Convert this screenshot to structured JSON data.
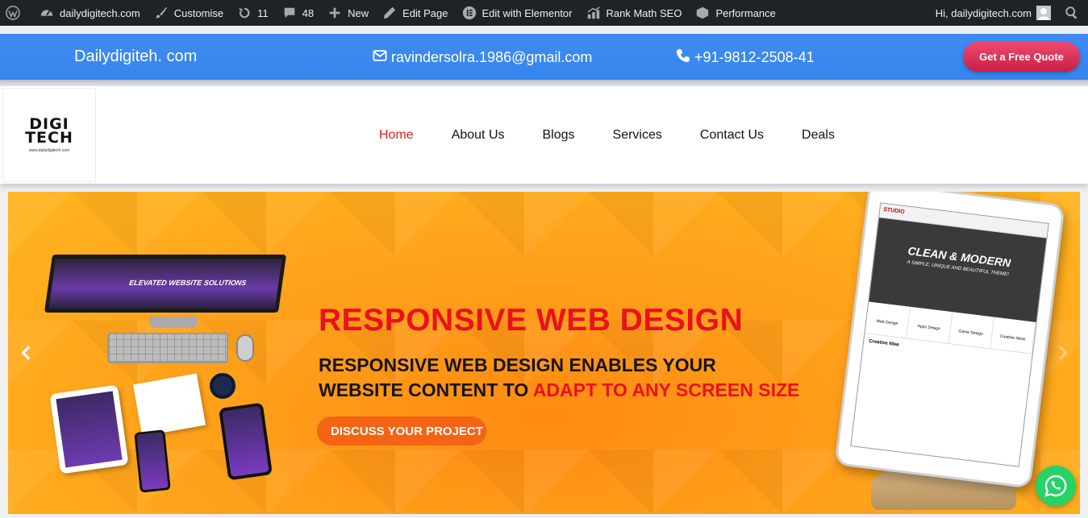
{
  "admin_bar": {
    "site": "dailydigitech.com",
    "customise": "Customise",
    "updates": "11",
    "comments": "48",
    "new": "New",
    "edit_page": "Edit Page",
    "elementor": "Edit with Elementor",
    "rank_math": "Rank Math SEO",
    "performance": "Performance",
    "greeting": "Hi, dailydigitech.com"
  },
  "top_bar": {
    "brand": "Dailydigiteh. com",
    "email": "ravindersolra.1986@gmail.com",
    "phone": "+91-9812-2508-41",
    "cta": "Get a Free Quote"
  },
  "logo": {
    "line1": "DIGI",
    "line2": "TECH",
    "url_text": "www.dailydigitech.com"
  },
  "nav": {
    "items": [
      "Home",
      "About Us",
      "Blogs",
      "Services",
      "Contact Us",
      "Deals"
    ],
    "active": "Home"
  },
  "hero": {
    "headline": "RESPONSIVE WEB DESIGN",
    "sub_line1": "RESPONSIVE WEB DESIGN ENABLES YOUR",
    "sub_line2_a": "WEBSITE CONTENT TO ",
    "sub_line2_b": "ADAPT TO ANY SCREEN SIZE",
    "button": "DISCUSS YOUR PROJECT",
    "monitor_text": "ELEVATED WEBSITE SOLUTIONS",
    "tablet_brand": "STUDIO",
    "tablet_title": "CLEAN & MODERN",
    "tablet_sub": "A SIMPLE, UNIQUE AND BEAUTIFUL THEME!",
    "tablet_icons": [
      "Web Design",
      "Apps Design",
      "Game Design",
      "Creative Ideas"
    ],
    "tablet_block": "Creative Idea"
  },
  "colors": {
    "admin_bg": "#1d2327",
    "topbar_blue": "#3f8cf2",
    "cta_red": "#c81f48",
    "nav_active": "#e11d1d",
    "hero_orange": "#ff9e1a",
    "headline_red": "#e8121c",
    "whatsapp_green": "#25d366"
  }
}
